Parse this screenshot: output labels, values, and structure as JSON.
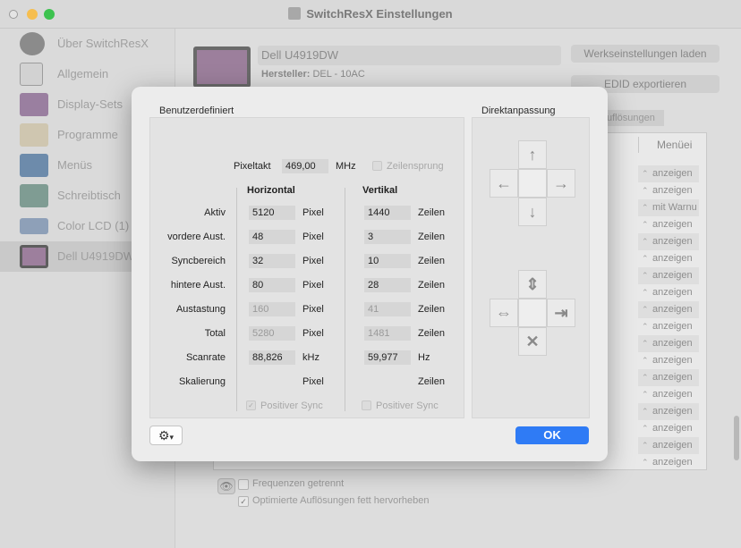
{
  "window": {
    "title": "SwitchResX Einstellungen"
  },
  "sidebar": {
    "items": [
      {
        "label": "Über SwitchResX",
        "icon": "gear-icon"
      },
      {
        "label": "Allgemein",
        "icon": "switch-icon"
      },
      {
        "label": "Display-Sets",
        "icon": "display-set-icon"
      },
      {
        "label": "Programme",
        "icon": "app-icon"
      },
      {
        "label": "Menüs",
        "icon": "menu-icon"
      },
      {
        "label": "Schreibtisch",
        "icon": "desktop-icon"
      },
      {
        "label": "Color LCD (1)",
        "icon": "laptop-icon"
      },
      {
        "label": "Dell U4919DW",
        "icon": "monitor-icon"
      }
    ]
  },
  "monitor": {
    "name": "Dell U4919DW",
    "maker_label": "Hersteller:",
    "maker_value": "DEL - 10AC",
    "reset_button": "Werkseinstellungen laden",
    "edid_button": "EDID exportieren",
    "tab_partial": "uflösungen",
    "menu_header": "Menüei",
    "list_values": [
      "anzeigen",
      "anzeigen",
      "mit Warnu",
      "anzeigen",
      "anzeigen",
      "anzeigen",
      "anzeigen",
      "anzeigen",
      "anzeigen",
      "anzeigen",
      "anzeigen",
      "anzeigen",
      "anzeigen",
      "anzeigen",
      "anzeigen",
      "anzeigen",
      "anzeigen",
      "anzeigen"
    ],
    "freq_label": "Frequenzen getrennt",
    "optimize_label": "Optimierte Auflösungen fett hervorheben"
  },
  "dialog": {
    "section_custom": "Benutzerdefiniert",
    "section_direct": "Direktanpassung",
    "pixelclock_label": "Pixeltakt",
    "pixelclock_value": "469,00",
    "pixelclock_unit": "MHz",
    "interlace_label": "Zeilensprung",
    "horizontal_header": "Horizontal",
    "vertical_header": "Vertikal",
    "rows": [
      {
        "label": "Aktiv",
        "h": "5120",
        "hu": "Pixel",
        "v": "1440",
        "vu": "Zeilen"
      },
      {
        "label": "vordere Aust.",
        "h": "48",
        "hu": "Pixel",
        "v": "3",
        "vu": "Zeilen"
      },
      {
        "label": "Syncbereich",
        "h": "32",
        "hu": "Pixel",
        "v": "10",
        "vu": "Zeilen"
      },
      {
        "label": "hintere Aust.",
        "h": "80",
        "hu": "Pixel",
        "v": "28",
        "vu": "Zeilen"
      },
      {
        "label": "Austastung",
        "h": "160",
        "hu": "Pixel",
        "v": "41",
        "vu": "Zeilen"
      },
      {
        "label": "Total",
        "h": "5280",
        "hu": "Pixel",
        "v": "1481",
        "vu": "Zeilen"
      },
      {
        "label": "Scanrate",
        "h": "88,826",
        "hu": "kHz",
        "v": "59,977",
        "vu": "Hz"
      },
      {
        "label": "Skalierung",
        "h": "",
        "hu": "Pixel",
        "v": "",
        "vu": "Zeilen"
      }
    ],
    "pos_sync_h": "Positiver Sync",
    "pos_sync_v": "Positiver Sync",
    "ok_button": "OK"
  },
  "colors": {
    "accent": "#2f7bf5",
    "window_bg": "#ececec"
  }
}
